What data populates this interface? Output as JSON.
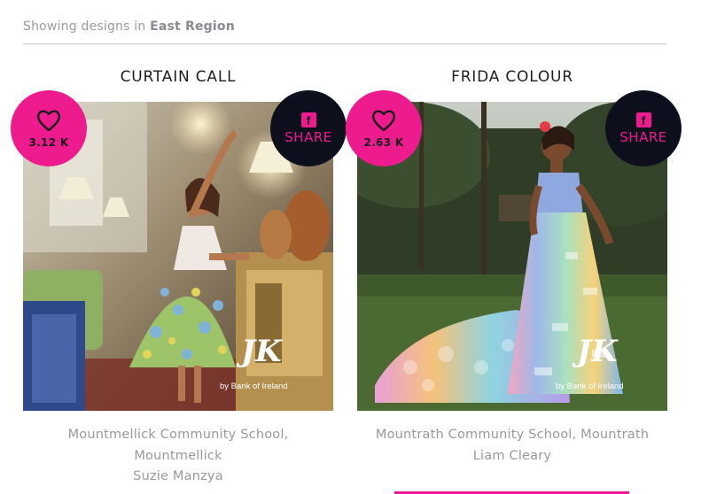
{
  "filter": {
    "prefix": "Showing designs in",
    "region": "East Region"
  },
  "designs": [
    {
      "title": "CURTAIN CALL",
      "likes": "3.12 K",
      "share_label": "SHARE",
      "facebook_glyph": "f",
      "logo_text": "JK",
      "logo_sponsor": "by Bank of Ireland",
      "school_line1": "Mountmellick Community School,",
      "school_line2": "Mountmellick",
      "designer": "Suzie Manzya"
    },
    {
      "title": "FRIDA COLOUR",
      "likes": "2.63 K",
      "share_label": "SHARE",
      "facebook_glyph": "f",
      "logo_text": "JK",
      "logo_sponsor": "by Bank of Ireland",
      "school_line1": "Mountrath Community School, Mountrath",
      "designer": "Liam Cleary"
    }
  ],
  "colors": {
    "accent": "#ee1b8e",
    "share_badge_bg": "#0e0f1c",
    "caption_text": "#98989e"
  },
  "icons": [
    "heart-icon",
    "facebook-icon"
  ]
}
